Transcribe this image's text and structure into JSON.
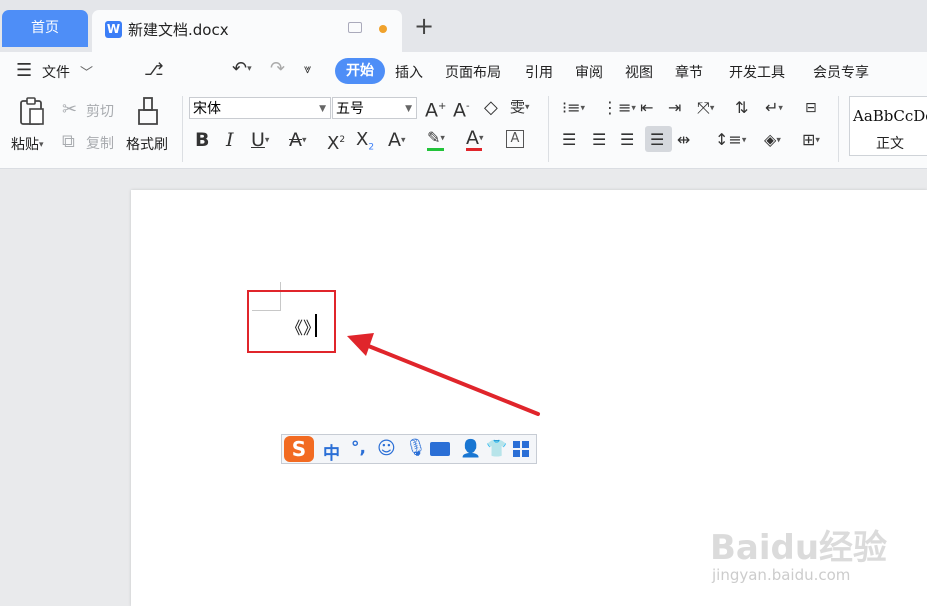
{
  "tabs": {
    "home_label": "首页",
    "doc_title": "新建文档.docx",
    "doc_icon": "W",
    "new_tab_symbol": "+"
  },
  "menu": {
    "file_label": "文件",
    "items": [
      "开始",
      "插入",
      "页面布局",
      "引用",
      "审阅",
      "视图",
      "章节",
      "开发工具",
      "会员专享"
    ]
  },
  "ribbon": {
    "paste_label": "粘贴",
    "cut_label": "剪切",
    "copy_label": "复制",
    "format_painter_label": "格式刷",
    "font_name": "宋体",
    "font_size": "五号",
    "bold": "B",
    "italic": "I",
    "underline": "U",
    "style_preview": "AaBbCcDd",
    "style_name": "正文"
  },
  "document": {
    "typed_text": "《》"
  },
  "ime": {
    "logo": "S",
    "mode": "中",
    "punct": "°,"
  },
  "watermark": {
    "brand": "Baidu经验",
    "url": "jingyan.baidu.com"
  },
  "colors": {
    "accent": "#4e8ef7",
    "annotation_red": "#e0252b",
    "highlight_green": "#22c33a",
    "font_color_red": "#e0252b",
    "ime_orange": "#f26b22"
  }
}
